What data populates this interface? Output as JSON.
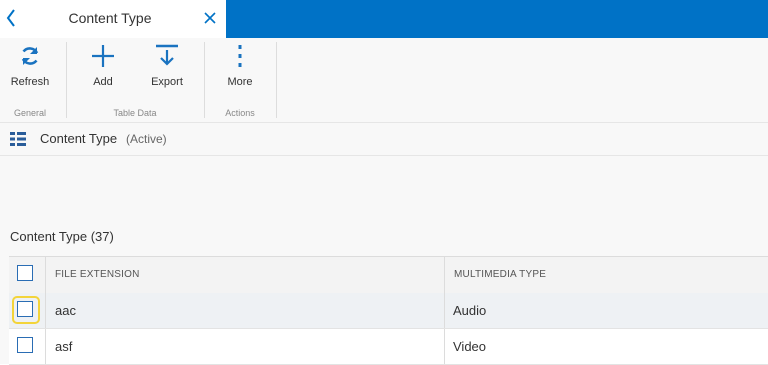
{
  "tab": {
    "title": "Content Type"
  },
  "ribbon": {
    "refresh_label": "Refresh",
    "add_label": "Add",
    "export_label": "Export",
    "more_label": "More",
    "groups": {
      "general": "General",
      "table_data": "Table Data",
      "actions": "Actions"
    }
  },
  "view": {
    "title": "Content Type",
    "state": "(Active)"
  },
  "table": {
    "heading": "Content Type (37)",
    "columns": [
      "FILE EXTENSION",
      "MULTIMEDIA TYPE"
    ],
    "rows": [
      {
        "extension": "aac",
        "type": "Audio"
      },
      {
        "extension": "asf",
        "type": "Video"
      }
    ]
  },
  "colors": {
    "accent": "#0072c6",
    "focus": "#f3d43a",
    "checkbox": "#2a6db4"
  },
  "icons": [
    "back-icon",
    "close-icon",
    "refresh-icon",
    "plus-icon",
    "export-icon",
    "more-icon",
    "grid-view-icon"
  ]
}
